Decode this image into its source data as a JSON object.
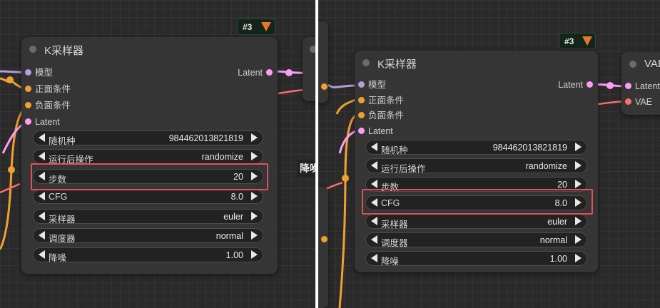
{
  "node": {
    "badge": "#3",
    "title": "K采样器",
    "inputs": [
      "模型",
      "正面条件",
      "负面条件",
      "Latent"
    ],
    "output": "Latent"
  },
  "widgets": [
    {
      "label": "随机种",
      "value": "984462013821819"
    },
    {
      "label": "运行后操作",
      "value": "randomize"
    },
    {
      "label": "步数",
      "value": "20"
    },
    {
      "label": "CFG",
      "value": "8.0"
    },
    {
      "label": "采样器",
      "value": "euler"
    },
    {
      "label": "调度器",
      "value": "normal"
    },
    {
      "label": "降噪",
      "value": "1.00"
    }
  ],
  "vae_node": {
    "title": "VAE",
    "inputs": [
      "Latent",
      "VAE"
    ]
  },
  "left_partial_tag": "降噪",
  "colors": {
    "model": "#b39ddb",
    "conditioning": "#f0a030",
    "latent": "#ff9cf9",
    "vae": "#ff6e6e",
    "highlight": "#e0505a"
  },
  "icons": [
    "fox-icon",
    "arrow-left-icon",
    "arrow-right-icon"
  ]
}
